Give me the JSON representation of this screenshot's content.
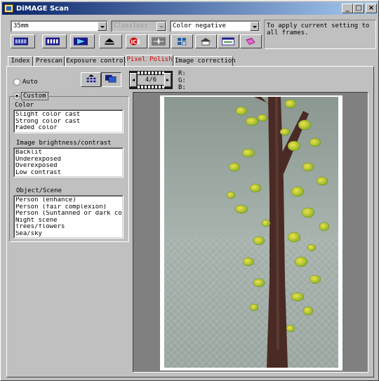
{
  "window": {
    "title": "DiMAGE Scan"
  },
  "titlebar_buttons": [
    "_",
    "□",
    "×"
  ],
  "toolbar": {
    "film_type": "35mm",
    "film_brand": "Classless",
    "color_mode": "Color negative",
    "hint": "To apply current setting to\nall frames."
  },
  "tabs": [
    {
      "label": "Index",
      "active": false
    },
    {
      "label": "Prescan",
      "active": false
    },
    {
      "label": "Exposure control",
      "active": false
    },
    {
      "label": "Pixel Polish",
      "active": true
    },
    {
      "label": "Image correction",
      "active": false
    }
  ],
  "pixel_polish": {
    "auto_label": "Auto",
    "custom_label": "Custom",
    "custom_selected": true,
    "color_label": "Color",
    "color_items": [
      "Slight color cast",
      "Strong color cast",
      "Faded color"
    ],
    "brightness_label": "Image brightness/contrast",
    "brightness_items": [
      "Backlit",
      "Underexposed",
      "Overexposed",
      "Low contrast"
    ],
    "scene_label": "Object/Scene",
    "scene_items": [
      "Person (enhance)",
      "Person (fair complexion)",
      "Person (Suntanned or dark comple",
      "Night scene",
      "Trees/flowers",
      "Sea/sky"
    ]
  },
  "frame": {
    "counter": "4/6",
    "prev": "◀",
    "next": "▶"
  },
  "rgb_readout": {
    "r": "R:",
    "g": "G:",
    "b": "B:"
  },
  "colors": {
    "title_start": "#0a246a",
    "title_end": "#a6caf0",
    "active_tab": "#e00000",
    "face": "#c0c0c0"
  },
  "icons": [
    "app-icon",
    "index-scan-icon",
    "prescan-icon",
    "scan-icon",
    "eject-icon",
    "ice-icon",
    "easy-scan-icon",
    "batch-icon",
    "home-icon",
    "preferences-icon",
    "help-icon",
    "apply-all-icon",
    "compare-icon"
  ]
}
